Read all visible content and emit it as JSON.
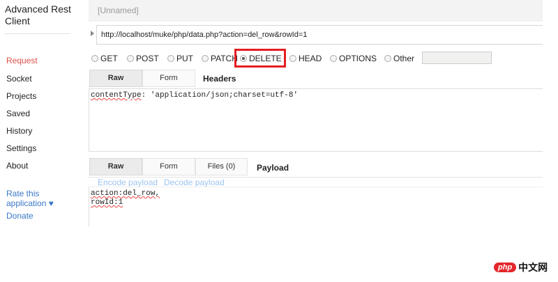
{
  "app": {
    "title": "Advanced Rest Client"
  },
  "sidebar": {
    "items": [
      {
        "label": "Request",
        "active": true
      },
      {
        "label": "Socket"
      },
      {
        "label": "Projects"
      },
      {
        "label": "Saved"
      },
      {
        "label": "History"
      },
      {
        "label": "Settings"
      },
      {
        "label": "About"
      }
    ],
    "rate_label": "Rate this application ♥",
    "donate_label": "Donate"
  },
  "request": {
    "name": "[Unnamed]",
    "url": "http://localhost/muke/php/data.php?action=del_row&rowId=1",
    "methods": [
      "GET",
      "POST",
      "PUT",
      "PATCH",
      "DELETE",
      "HEAD",
      "OPTIONS",
      "Other"
    ],
    "selected_method": "DELETE",
    "other_value": ""
  },
  "headers": {
    "tabs": [
      "Raw",
      "Form"
    ],
    "active_tab": "Raw",
    "title": "Headers",
    "raw_key": "contentType",
    "raw_rest": ": 'application/json;charset=utf-8'"
  },
  "payload": {
    "tabs": [
      "Raw",
      "Form",
      "Files (0)"
    ],
    "active_tab": "Raw",
    "title": "Payload",
    "encode_label": "Encode payload",
    "decode_label": "Decode payload",
    "line1": "action:del_row,",
    "line2": "rowId:1"
  },
  "watermark": {
    "logo": "php",
    "text": "中文网"
  },
  "colors": {
    "active_nav": "#e0504a",
    "link": "#3a78c8",
    "highlight": "#e51d24"
  }
}
